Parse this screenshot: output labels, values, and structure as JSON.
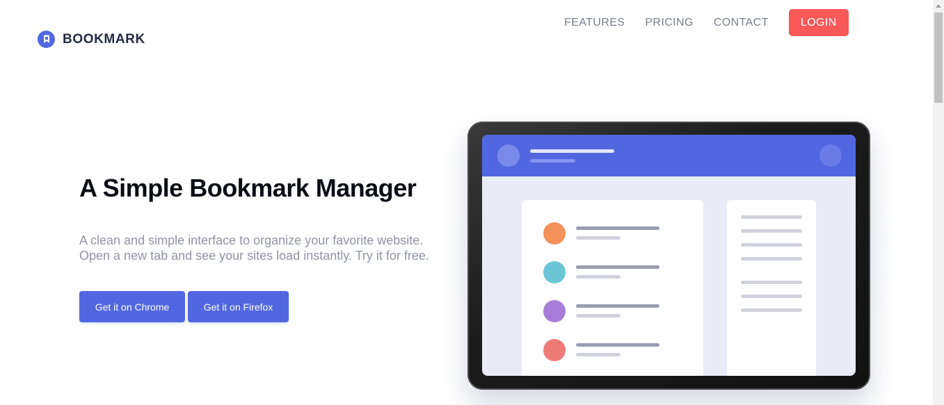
{
  "header": {
    "logo_text": "BOOKMARK",
    "nav": [
      "FEATURES",
      "PRICING",
      "CONTACT"
    ],
    "login_label": "LOGIN"
  },
  "hero": {
    "title": "A Simple Bookmark Manager",
    "description": "A clean and simple interface to organize your favorite website. Open a new tab and see your sites load instantly. Try it for free.",
    "chrome_button": "Get it on Chrome",
    "firefox_button": "Get it on Firefox"
  },
  "illustration": {
    "list_dot_colors": [
      "#F4915A",
      "#6CC5D5",
      "#A87DD8",
      "#EE7A77"
    ]
  },
  "colors": {
    "primary": "#5267DF",
    "accent": "#FA5959",
    "text_dark": "#242A45",
    "text_grey": "#9194A2"
  }
}
